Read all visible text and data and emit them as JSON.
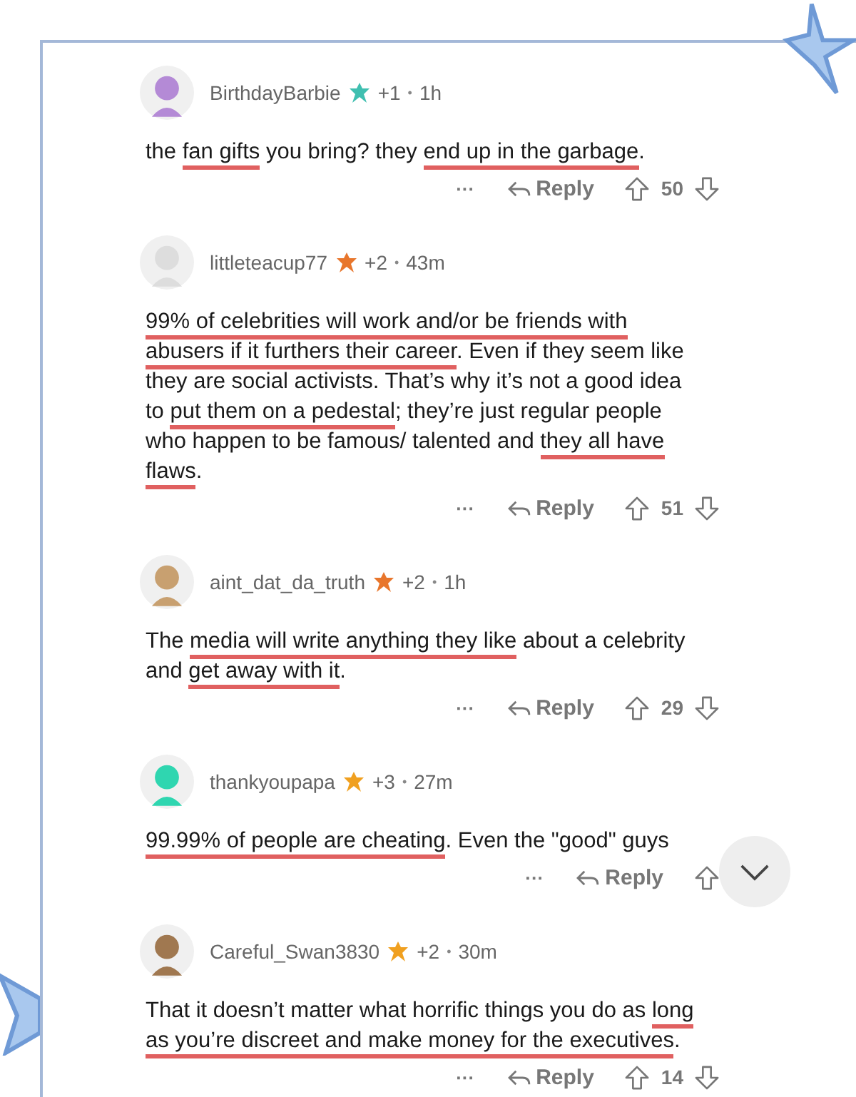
{
  "comments": [
    {
      "username": "BirthdayBarbie",
      "award_count": "+1",
      "separator": "•",
      "time": "1h",
      "body": [
        {
          "text": "the ",
          "underlined": false
        },
        {
          "text": "fan gifts",
          "underlined": true
        },
        {
          "text": " you bring? they ",
          "underlined": false
        },
        {
          "text": "end up in the garbage",
          "underlined": true
        },
        {
          "text": ".",
          "underlined": false
        }
      ],
      "more": "···",
      "reply": "Reply",
      "votes": "50"
    },
    {
      "username": "littleteacup77",
      "award_count": "+2",
      "separator": "•",
      "time": "43m",
      "body": [
        {
          "text": "99% of celebrities will work and/or be friends with abusers if it furthers their career",
          "underlined": true
        },
        {
          "text": ". Even if they seem like they are social activists. That’s why it’s not a good idea to ",
          "underlined": false
        },
        {
          "text": "put them on a pedestal",
          "underlined": true
        },
        {
          "text": "; they’re just regular people who happen to be famous/ talented and ",
          "underlined": false
        },
        {
          "text": "they all have flaws",
          "underlined": true
        },
        {
          "text": ".",
          "underlined": false
        }
      ],
      "more": "···",
      "reply": "Reply",
      "votes": "51"
    },
    {
      "username": "aint_dat_da_truth",
      "award_count": "+2",
      "separator": "•",
      "time": "1h",
      "body": [
        {
          "text": "The ",
          "underlined": false
        },
        {
          "text": "media will write anything they like",
          "underlined": true
        },
        {
          "text": " about a celebrity and ",
          "underlined": false
        },
        {
          "text": "get away with it",
          "underlined": true
        },
        {
          "text": ".",
          "underlined": false
        }
      ],
      "more": "···",
      "reply": "Reply",
      "votes": "29"
    },
    {
      "username": "thankyoupapa",
      "award_count": "+3",
      "separator": "•",
      "time": "27m",
      "body": [
        {
          "text": "99.99% of people are cheating",
          "underlined": true
        },
        {
          "text": ". Even the \"good\" guys",
          "underlined": false
        }
      ],
      "more": "···",
      "reply": "Reply"
    },
    {
      "username": "Careful_Swan3830",
      "award_count": "+2",
      "separator": "•",
      "time": "30m",
      "body": [
        {
          "text": "That it doesn’t matter what horrific things you do as ",
          "underlined": false
        },
        {
          "text": "long as you’re discreet and make money for the executives",
          "underlined": true
        },
        {
          "text": ".",
          "underlined": false
        }
      ],
      "more": "···",
      "reply": "Reply",
      "votes": "14"
    }
  ]
}
